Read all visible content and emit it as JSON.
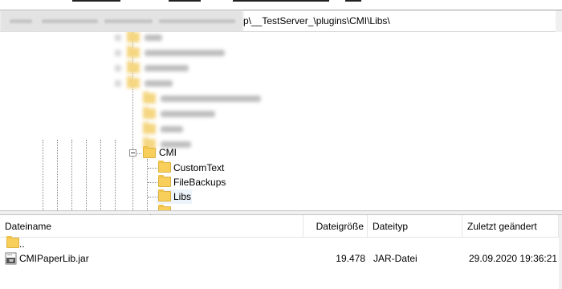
{
  "path_bar": {
    "visible_path": "p\\__TestServer_\\plugins\\CMI\\Libs\\"
  },
  "tree": {
    "cmi_label": "CMI",
    "children": [
      "CustomText",
      "FileBackups",
      "Libs"
    ],
    "selected": "Libs"
  },
  "file_list": {
    "columns": {
      "name": "Dateiname",
      "size": "Dateigröße",
      "type": "Dateityp",
      "modified": "Zuletzt geändert"
    },
    "rows": [
      {
        "name": "..",
        "size": "",
        "type": "",
        "modified": ""
      },
      {
        "name": "CMIPaperLib.jar",
        "size": "19.478",
        "type": "JAR-Datei",
        "modified": "29.09.2020 19:36:21"
      }
    ]
  },
  "colors": {
    "folder": "#f7cf5a",
    "selection": "#eef4fb"
  }
}
